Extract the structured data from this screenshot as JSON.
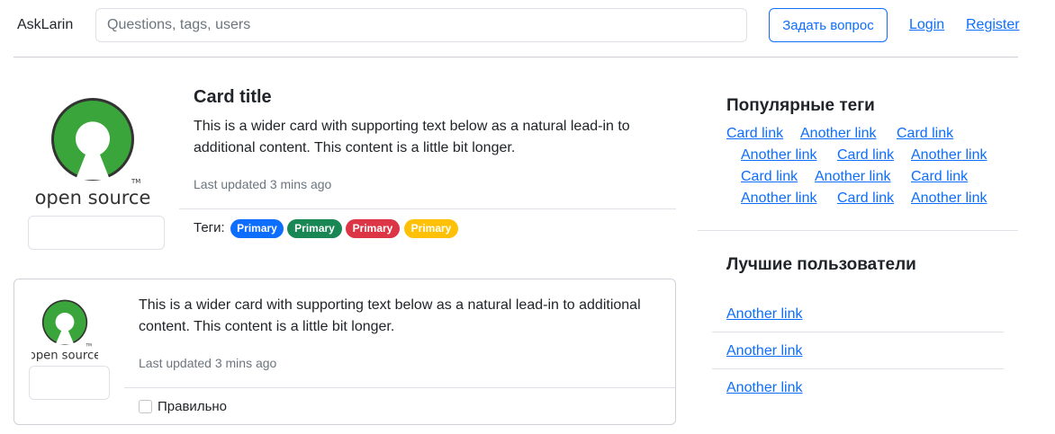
{
  "header": {
    "brand": "AskLarin",
    "search_placeholder": "Questions, tags, users",
    "ask_button": "Задать вопрос",
    "login": "Login",
    "register": "Register"
  },
  "question": {
    "title": "Card title",
    "text": "This is a wider card with supporting text below as a natural lead-in to additional content. This content is a little bit longer.",
    "updated": "Last updated 3 mins ago",
    "tags_label": "Теги:",
    "tags": [
      {
        "label": "Primary",
        "color": "#0d6efd"
      },
      {
        "label": "Primary",
        "color": "#198754"
      },
      {
        "label": "Primary",
        "color": "#dc3545"
      },
      {
        "label": "Primary",
        "color": "#ffc107"
      }
    ],
    "logo_text": "open source"
  },
  "answer": {
    "text": "This is a wider card with supporting text below as a natural lead-in to additional content. This content is a little bit longer.",
    "updated": "Last updated 3 mins ago",
    "checkbox_label": "Правильно",
    "logo_text": "open source"
  },
  "sidebar": {
    "popular_tags_title": "Популярные теги",
    "tag_links": [
      "Card link",
      "Another link",
      "Card link",
      "Another link",
      "Card link",
      "Another link",
      "Card link",
      "Another link",
      "Card link",
      "Another link",
      "Card link",
      "Another link"
    ],
    "best_users_title": "Лучшие пользователи",
    "user_links": [
      "Another link",
      "Another link",
      "Another link"
    ]
  },
  "colors": {
    "accent": "#0d6efd",
    "logo_green": "#3aa53a"
  }
}
